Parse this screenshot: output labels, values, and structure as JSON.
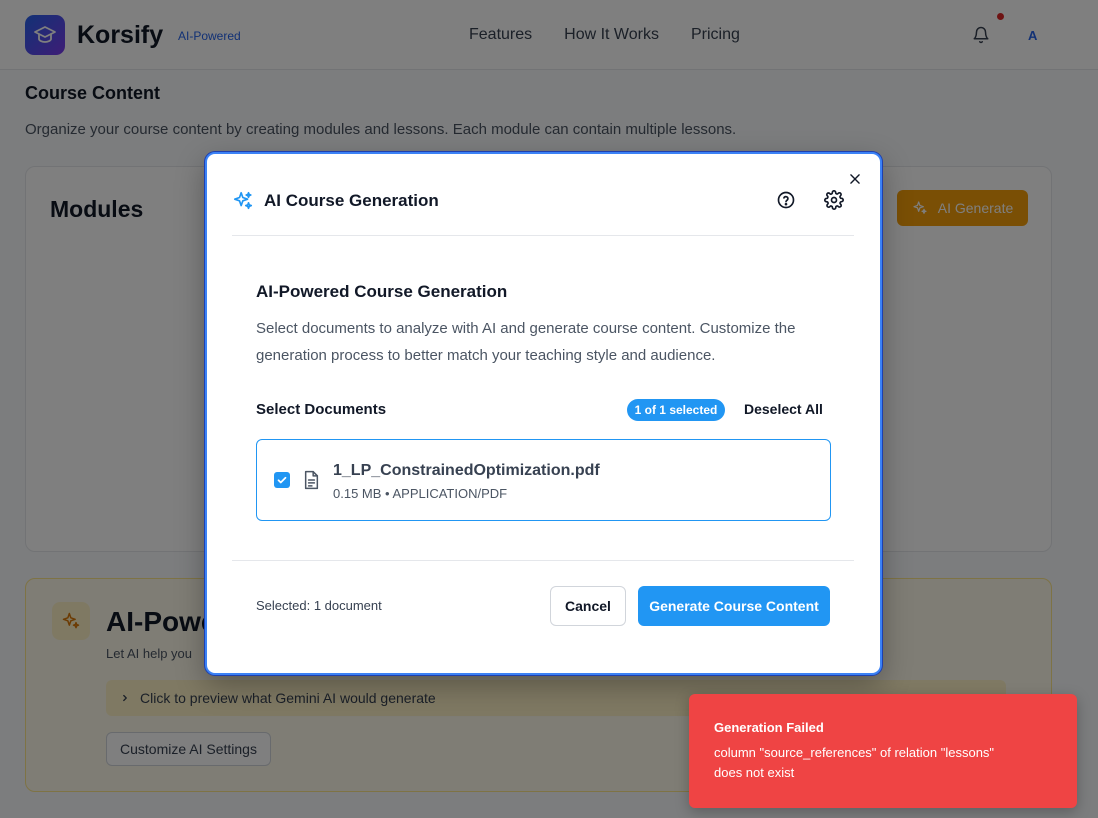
{
  "header": {
    "brand": "Korsify",
    "brand_tag": "AI-Powered",
    "nav": [
      "Features",
      "How It Works",
      "Pricing"
    ],
    "avatar_initial": "A"
  },
  "content": {
    "section_title": "Course Content",
    "section_desc": "Organize your course content by creating modules and lessons. Each module can contain multiple lessons.",
    "modules_title": "Modules",
    "ai_generate_label": "AI Generate",
    "ai_card_title": "AI-Powered Course Generation",
    "ai_card_subtitle": "Let AI help you",
    "preview_label": "Click to preview what Gemini AI would generate",
    "customize_label": "Customize AI Settings"
  },
  "modal": {
    "title": "AI Course Generation",
    "heading": "AI-Powered Course Generation",
    "description": "Select documents to analyze with AI and generate course content. Customize the generation process to better match your teaching style and audience.",
    "select_label": "Select Documents",
    "selected_badge": "1 of 1 selected",
    "deselect_label": "Deselect All",
    "document": {
      "name": "1_LP_ConstrainedOptimization.pdf",
      "meta": "0.15 MB • APPLICATION/PDF",
      "checked": true
    },
    "selected_summary": "Selected: 1 document",
    "cancel_label": "Cancel",
    "generate_label": "Generate Course Content"
  },
  "toast": {
    "title": "Generation Failed",
    "message": "column \"source_references\" of relation \"lessons\" does not exist"
  },
  "colors": {
    "primary": "#2196f3",
    "amber": "#f59e0b",
    "error": "#ef4444"
  }
}
